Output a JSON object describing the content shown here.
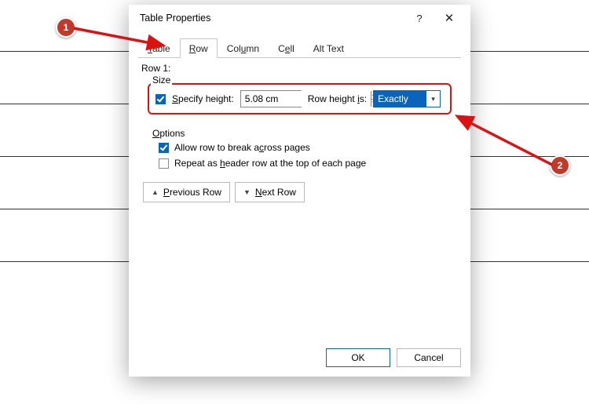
{
  "dialog": {
    "title": "Table Properties",
    "tabs": {
      "table": "Table",
      "row": "Row",
      "column": "Column",
      "cell": "Cell",
      "alttext": "Alt Text"
    },
    "row_label": "Row 1:",
    "size": {
      "legend": "Size",
      "specify_pre": "S",
      "specify_post": "pecify height:",
      "height_value": "5.08 cm",
      "rowheight_pre": "Row height ",
      "rowheight_u": "i",
      "rowheight_post": "s:",
      "select_value": "Exactly"
    },
    "options": {
      "legend_pre": "O",
      "legend_post": "ptions",
      "allow_pre": "Allow row to break a",
      "allow_u": "c",
      "allow_post": "ross pages",
      "repeat_pre": "Repeat as ",
      "repeat_u": "h",
      "repeat_post": "eader row at the top of each page"
    },
    "nav": {
      "prev_u": "P",
      "prev_post": "revious Row",
      "next_u": "N",
      "next_post": "ext Row"
    },
    "buttons": {
      "ok": "OK",
      "cancel": "Cancel"
    }
  },
  "callouts": {
    "one": "1",
    "two": "2"
  }
}
